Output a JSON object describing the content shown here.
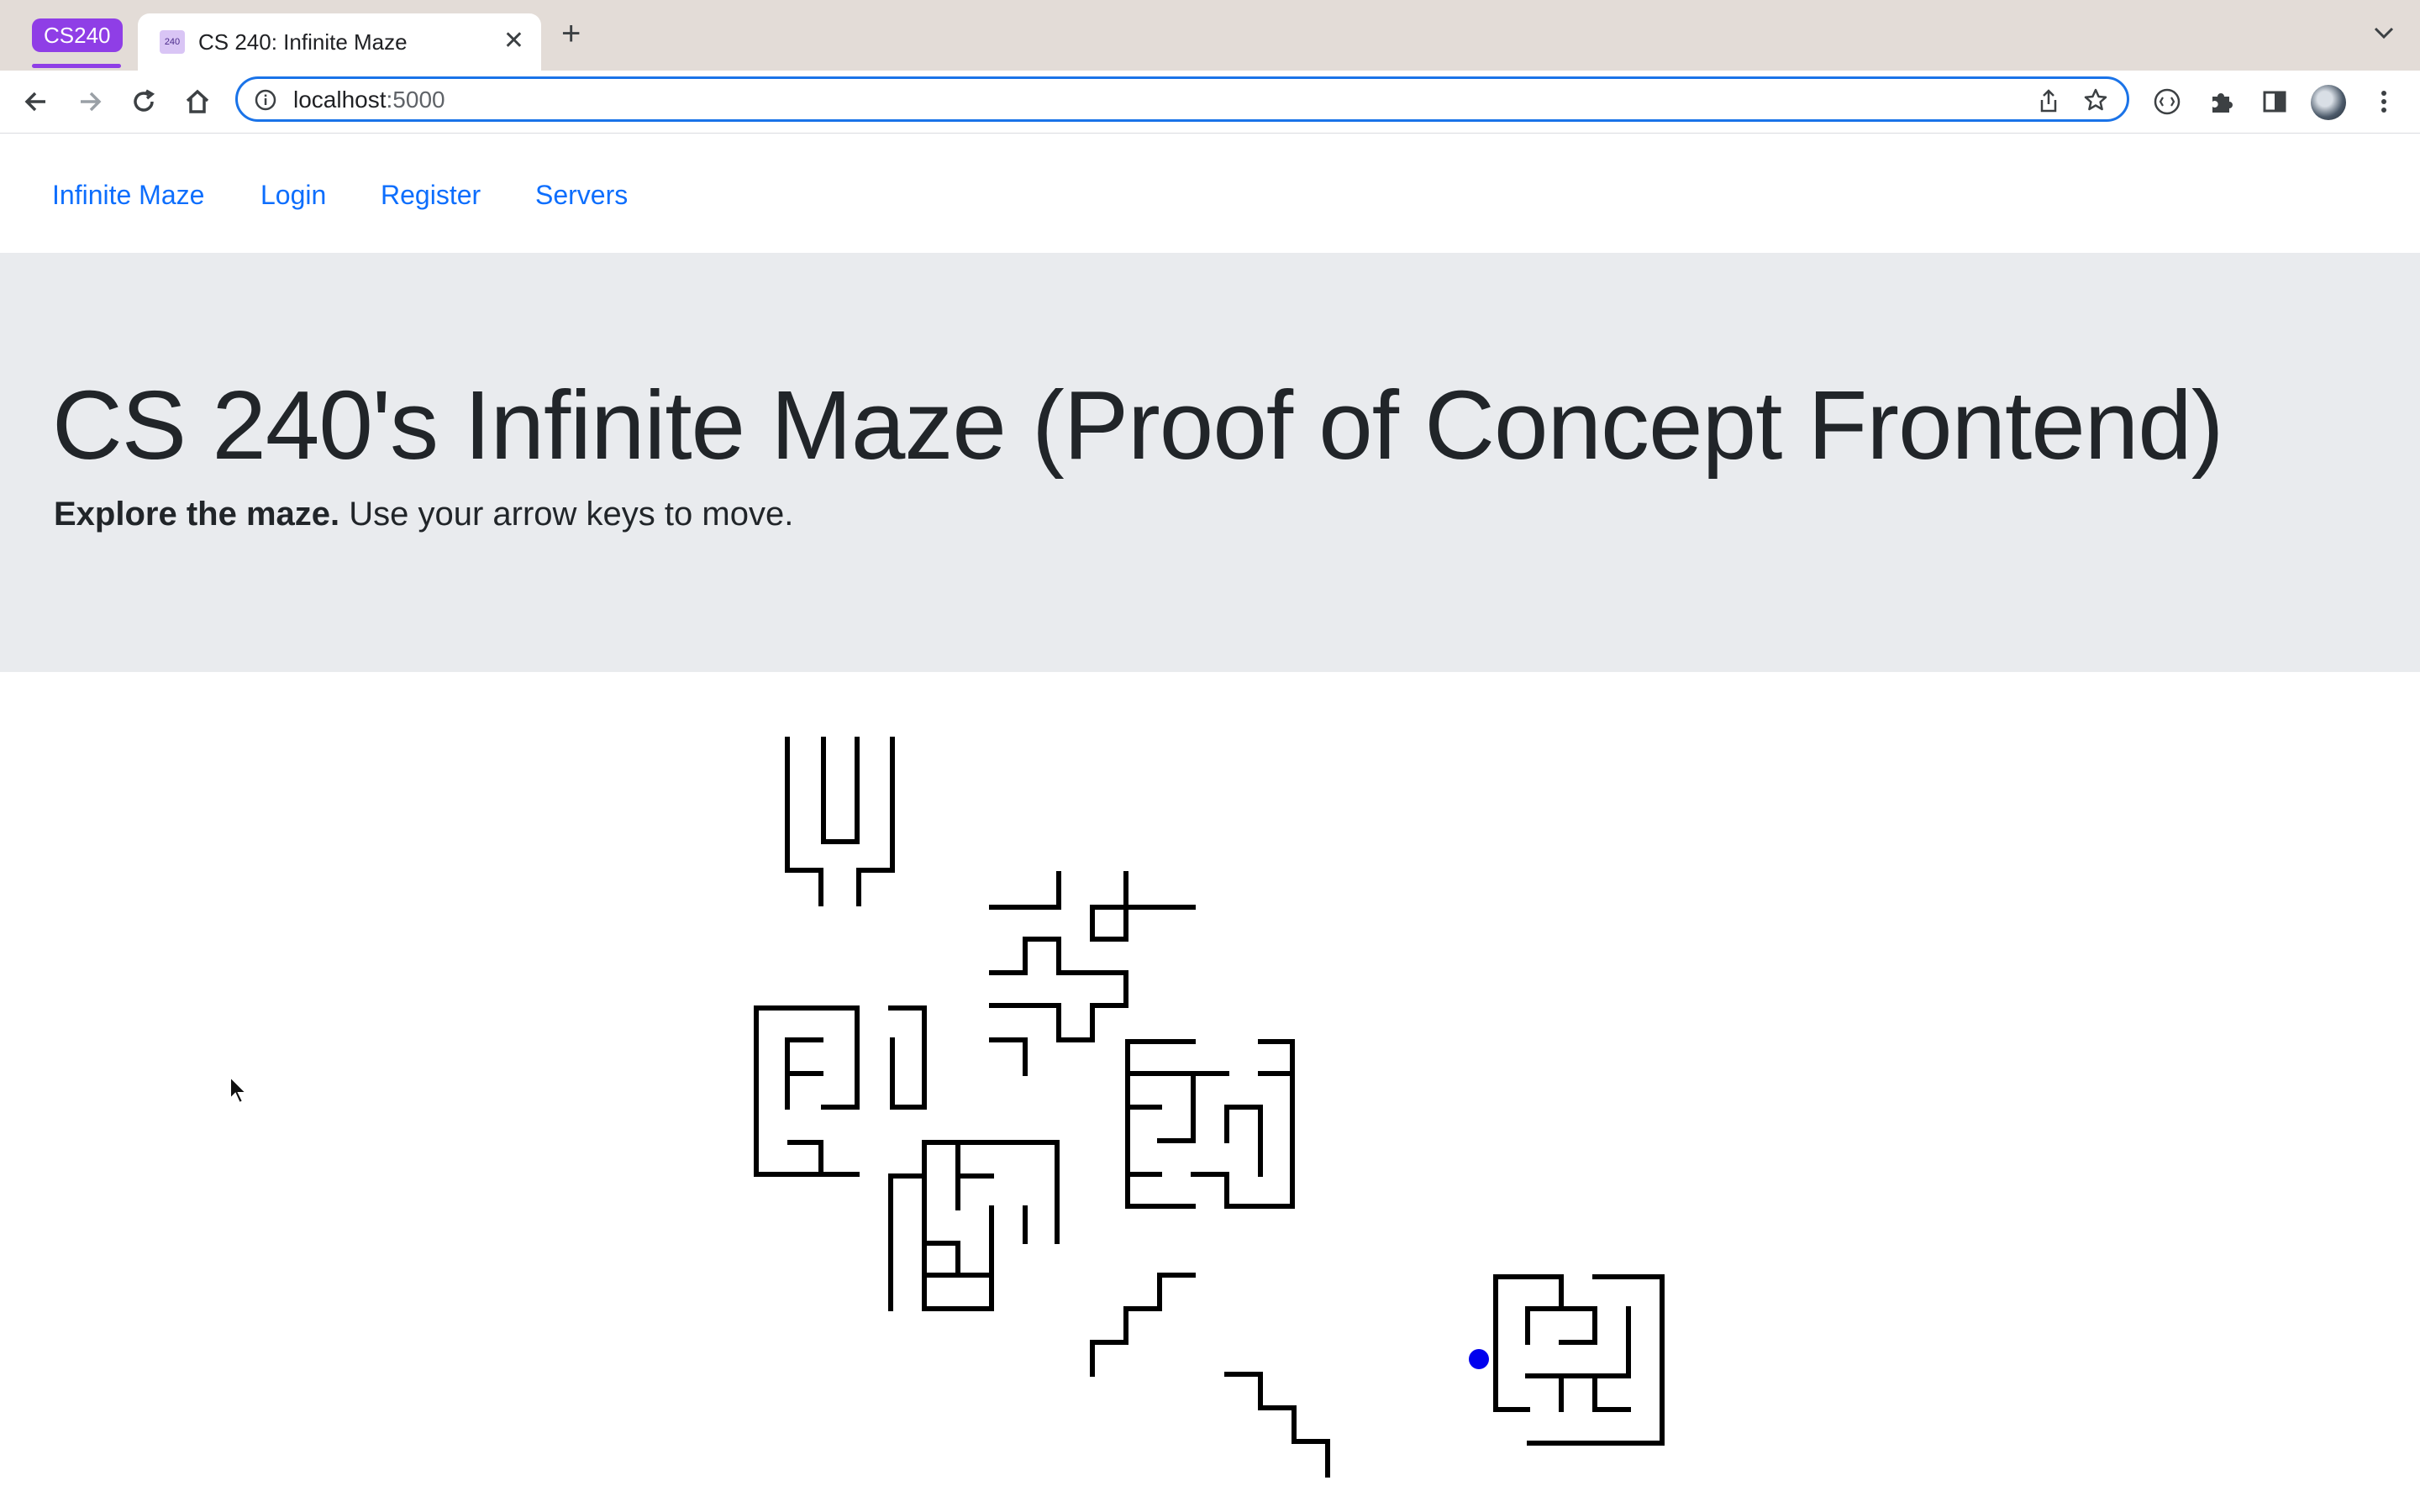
{
  "browser": {
    "tab_group": "CS240",
    "tab_title": "CS 240: Infinite Maze",
    "tab_favicon_text": "240",
    "url_host": "localhost",
    "url_port": ":5000"
  },
  "nav": {
    "brand": "Infinite Maze",
    "items": [
      "Login",
      "Register",
      "Servers"
    ]
  },
  "hero": {
    "title": "CS 240's Infinite Maze (Proof of Concept Frontend)",
    "lead_bold": "Explore the maze.",
    "lead_rest": " Use your arrow keys to move."
  },
  "maze": {
    "wall_color": "#000000",
    "player_color": "#0000ee"
  }
}
